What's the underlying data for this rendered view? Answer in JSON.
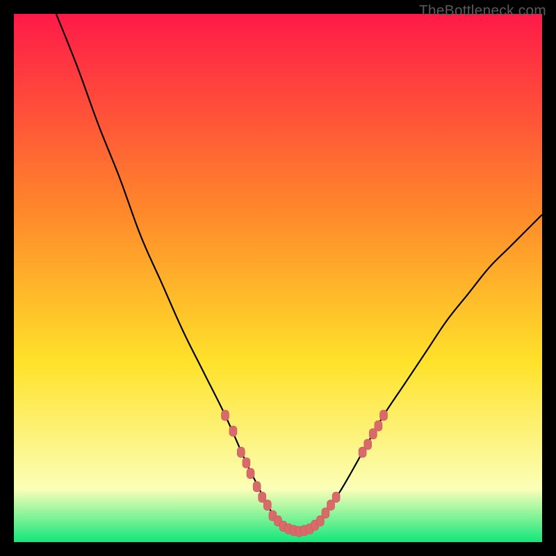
{
  "watermark": "TheBottleneck.com",
  "colors": {
    "black": "#000000",
    "curve": "#000000",
    "marker_fill": "#d96a6a",
    "marker_stroke": "#c95858",
    "gradient_top": "#ff1a48",
    "gradient_mid1": "#ff8a2a",
    "gradient_mid2": "#ffe22a",
    "gradient_pale": "#fbffb8",
    "gradient_bottom": "#12e67a"
  },
  "chart_data": {
    "type": "line",
    "title": "",
    "xlabel": "",
    "ylabel": "",
    "xlim": [
      0,
      100
    ],
    "ylim": [
      0,
      100
    ],
    "grid": false,
    "legend": false,
    "series": [
      {
        "name": "curve",
        "x": [
          8,
          12,
          16,
          20,
          24,
          28,
          32,
          36,
          40,
          44,
          46,
          48,
          50,
          52,
          54,
          56,
          58,
          62,
          66,
          70,
          74,
          78,
          82,
          86,
          90,
          94,
          98,
          100
        ],
        "y": [
          100,
          90,
          79,
          69,
          58,
          49,
          40,
          32,
          24,
          15,
          11,
          7,
          4,
          2.5,
          2,
          2.5,
          4,
          10,
          17,
          24,
          30,
          36,
          42,
          47,
          52,
          56,
          60,
          62
        ]
      }
    ],
    "markers": [
      {
        "x": 40,
        "y": 24
      },
      {
        "x": 41.5,
        "y": 21
      },
      {
        "x": 43,
        "y": 17
      },
      {
        "x": 44,
        "y": 15
      },
      {
        "x": 44.8,
        "y": 13
      },
      {
        "x": 46,
        "y": 10.5
      },
      {
        "x": 47,
        "y": 8.5
      },
      {
        "x": 48,
        "y": 7
      },
      {
        "x": 49,
        "y": 5
      },
      {
        "x": 50,
        "y": 4
      },
      {
        "x": 51,
        "y": 3
      },
      {
        "x": 52,
        "y": 2.5
      },
      {
        "x": 53,
        "y": 2.2
      },
      {
        "x": 54,
        "y": 2
      },
      {
        "x": 55,
        "y": 2.2
      },
      {
        "x": 56,
        "y": 2.5
      },
      {
        "x": 57,
        "y": 3.2
      },
      {
        "x": 58,
        "y": 4
      },
      {
        "x": 59,
        "y": 5.5
      },
      {
        "x": 60,
        "y": 7
      },
      {
        "x": 61,
        "y": 8.5
      },
      {
        "x": 66,
        "y": 17
      },
      {
        "x": 67,
        "y": 18.5
      },
      {
        "x": 68,
        "y": 20.5
      },
      {
        "x": 69,
        "y": 22
      },
      {
        "x": 70,
        "y": 24
      }
    ]
  }
}
